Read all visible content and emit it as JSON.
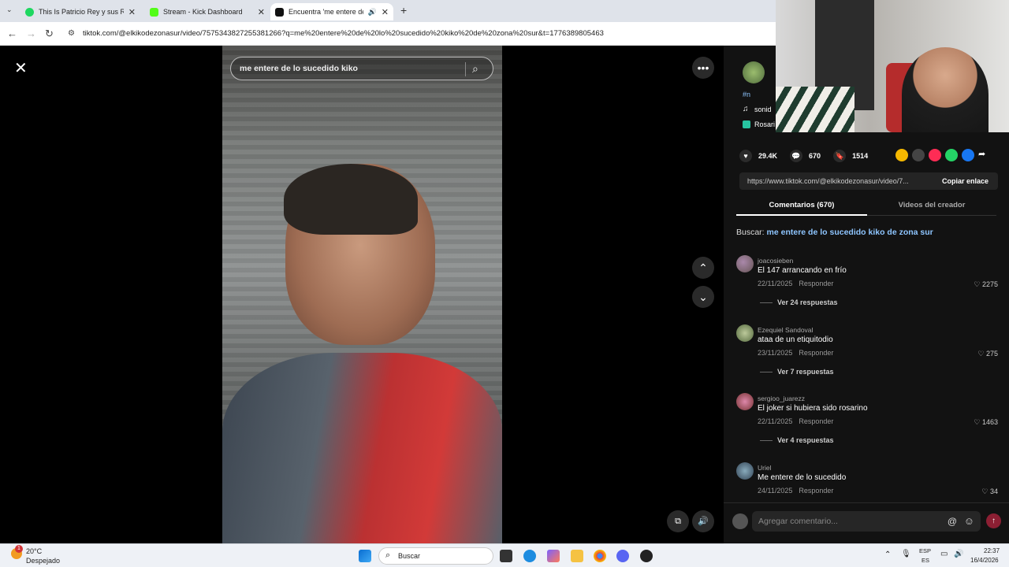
{
  "browser": {
    "tabs": [
      {
        "title": "This Is Patricio Rey y sus Redon",
        "color": "#1ed760"
      },
      {
        "title": "Stream - Kick Dashboard",
        "color": "#53fc18"
      },
      {
        "title": "Encuentra 'me entere de lo",
        "color": "#111111"
      }
    ],
    "url": "tiktok.com/@elkikodezonasur/video/7575343827255381266?q=me%20entere%20de%20lo%20sucedido%20kiko%20de%20zona%20sur&t=1776389805463"
  },
  "video": {
    "search_text": "me entere de lo sucedido kiko"
  },
  "panel": {
    "stats": {
      "likes": "29.4K",
      "comments": "670",
      "saves": "1514"
    },
    "share_colors": [
      "#f5b800",
      "#444444",
      "#fe2c55",
      "#25d366",
      "#1877f2"
    ],
    "link": "https://www.tiktok.com/@elkikodezonasur/video/7...",
    "copy_label": "Copiar enlace",
    "tab_comments": "Comentarios (670)",
    "tab_creator": "Videos del creador",
    "search_prefix": "Buscar:",
    "search_term": "me entere de lo sucedido kiko de zona sur",
    "creator_lines": [
      "#n",
      "sonid",
      "Rosari"
    ],
    "comments": [
      {
        "user": "joacosieben",
        "text": "El 147 arrancando en frío",
        "date": "22/11/2025",
        "reply": "Responder",
        "likes": "2275",
        "replies": "Ver 24 respuestas"
      },
      {
        "user": "Ezequiel Sandoval",
        "text": "ataa de un etiquitodio",
        "date": "23/11/2025",
        "reply": "Responder",
        "likes": "275",
        "replies": "Ver 7 respuestas"
      },
      {
        "user": "sergioo_juarezz",
        "text": "El joker si hubiera sido rosarino",
        "date": "22/11/2025",
        "reply": "Responder",
        "likes": "1463",
        "replies": "Ver 4 respuestas"
      },
      {
        "user": "Uriel",
        "text": "Me entere de lo sucedido",
        "date": "24/11/2025",
        "reply": "Responder",
        "likes": "34",
        "replies": ""
      }
    ],
    "composer_placeholder": "Agregar comentario..."
  },
  "taskbar": {
    "weather_temp": "20°C",
    "weather_desc": "Despejado",
    "search_label": "Buscar",
    "lang_top": "ESP",
    "lang_bottom": "ES",
    "time": "22:37",
    "date": "16/4/2026",
    "badge": "1"
  }
}
